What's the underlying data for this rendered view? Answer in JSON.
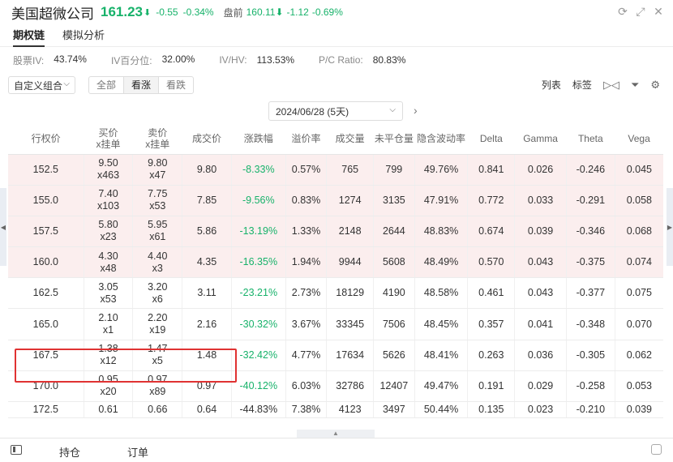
{
  "header": {
    "name": "美国超微公司",
    "price": "161.23",
    "arrow": "⬇",
    "change": "-0.55",
    "change_pct": "-0.34%",
    "premarket_label": "盘前",
    "premarket_price": "160.11⬇",
    "premarket_change": "-1.12",
    "premarket_pct": "-0.69%",
    "icons": [
      "refresh-icon",
      "expand-icon",
      "close-icon"
    ]
  },
  "tabs": [
    {
      "label": "期权链",
      "active": true
    },
    {
      "label": "模拟分析",
      "active": false
    }
  ],
  "stats": [
    {
      "label": "股票IV:",
      "value": "43.74%"
    },
    {
      "label": "IV百分位:",
      "value": "32.00%"
    },
    {
      "label": "IV/HV:",
      "value": "113.53%"
    },
    {
      "label": "P/C Ratio:",
      "value": "80.83%"
    }
  ],
  "toolbar": {
    "combo": "自定义组合",
    "filters": [
      "全部",
      "看涨",
      "看跌"
    ],
    "active_filter": "看涨",
    "list_label": "列表",
    "tag_label": "标签"
  },
  "expiry": {
    "selected": "2024/06/28 (5天)"
  },
  "columns": [
    "行权价",
    "买价\nx挂单",
    "卖价\nx挂单",
    "成交价",
    "涨跌幅",
    "溢价率",
    "成交量",
    "未平仓量",
    "隐含波动率",
    "Delta",
    "Gamma",
    "Theta",
    "Vega"
  ],
  "rows": [
    [
      "152.5",
      "9.50\nx463",
      "9.80\nx47",
      "9.80",
      "-8.33%",
      "0.57%",
      "765",
      "799",
      "49.76%",
      "0.841",
      "0.026",
      "-0.246",
      "0.045"
    ],
    [
      "155.0",
      "7.40\nx103",
      "7.75\nx53",
      "7.85",
      "-9.56%",
      "0.83%",
      "1274",
      "3135",
      "47.91%",
      "0.772",
      "0.033",
      "-0.291",
      "0.058"
    ],
    [
      "157.5",
      "5.80\nx23",
      "5.95\nx61",
      "5.86",
      "-13.19%",
      "1.33%",
      "2148",
      "2644",
      "48.83%",
      "0.674",
      "0.039",
      "-0.346",
      "0.068"
    ],
    [
      "160.0",
      "4.30\nx48",
      "4.40\nx3",
      "4.35",
      "-16.35%",
      "1.94%",
      "9944",
      "5608",
      "48.49%",
      "0.570",
      "0.043",
      "-0.375",
      "0.074"
    ],
    [
      "162.5",
      "3.05\nx53",
      "3.20\nx6",
      "3.11",
      "-23.21%",
      "2.73%",
      "18129",
      "4190",
      "48.58%",
      "0.461",
      "0.043",
      "-0.377",
      "0.075"
    ],
    [
      "165.0",
      "2.10\nx1",
      "2.20\nx19",
      "2.16",
      "-30.32%",
      "3.67%",
      "33345",
      "7506",
      "48.45%",
      "0.357",
      "0.041",
      "-0.348",
      "0.070"
    ],
    [
      "167.5",
      "1.38\nx12",
      "1.47\nx5",
      "1.48",
      "-32.42%",
      "4.77%",
      "17634",
      "5626",
      "48.41%",
      "0.263",
      "0.036",
      "-0.305",
      "0.062"
    ],
    [
      "170.0",
      "0.95\nx20",
      "0.97\nx89",
      "0.97",
      "-40.12%",
      "6.03%",
      "32786",
      "12407",
      "49.47%",
      "0.191",
      "0.029",
      "-0.258",
      "0.053"
    ],
    [
      "172.5",
      "0.61",
      "0.66",
      "0.64",
      "-44.83%",
      "7.38%",
      "4123",
      "3497",
      "50.44%",
      "0.135",
      "0.023",
      "-0.210",
      "0.039"
    ]
  ],
  "in_the_money_rows": 4,
  "highlighted_row": "167.5",
  "bottom": {
    "tab1": "持仓",
    "tab2": "订单"
  },
  "colors": {
    "down": "#17b26a",
    "itm_bg": "#fbeeee",
    "highlight": "#e03232"
  }
}
